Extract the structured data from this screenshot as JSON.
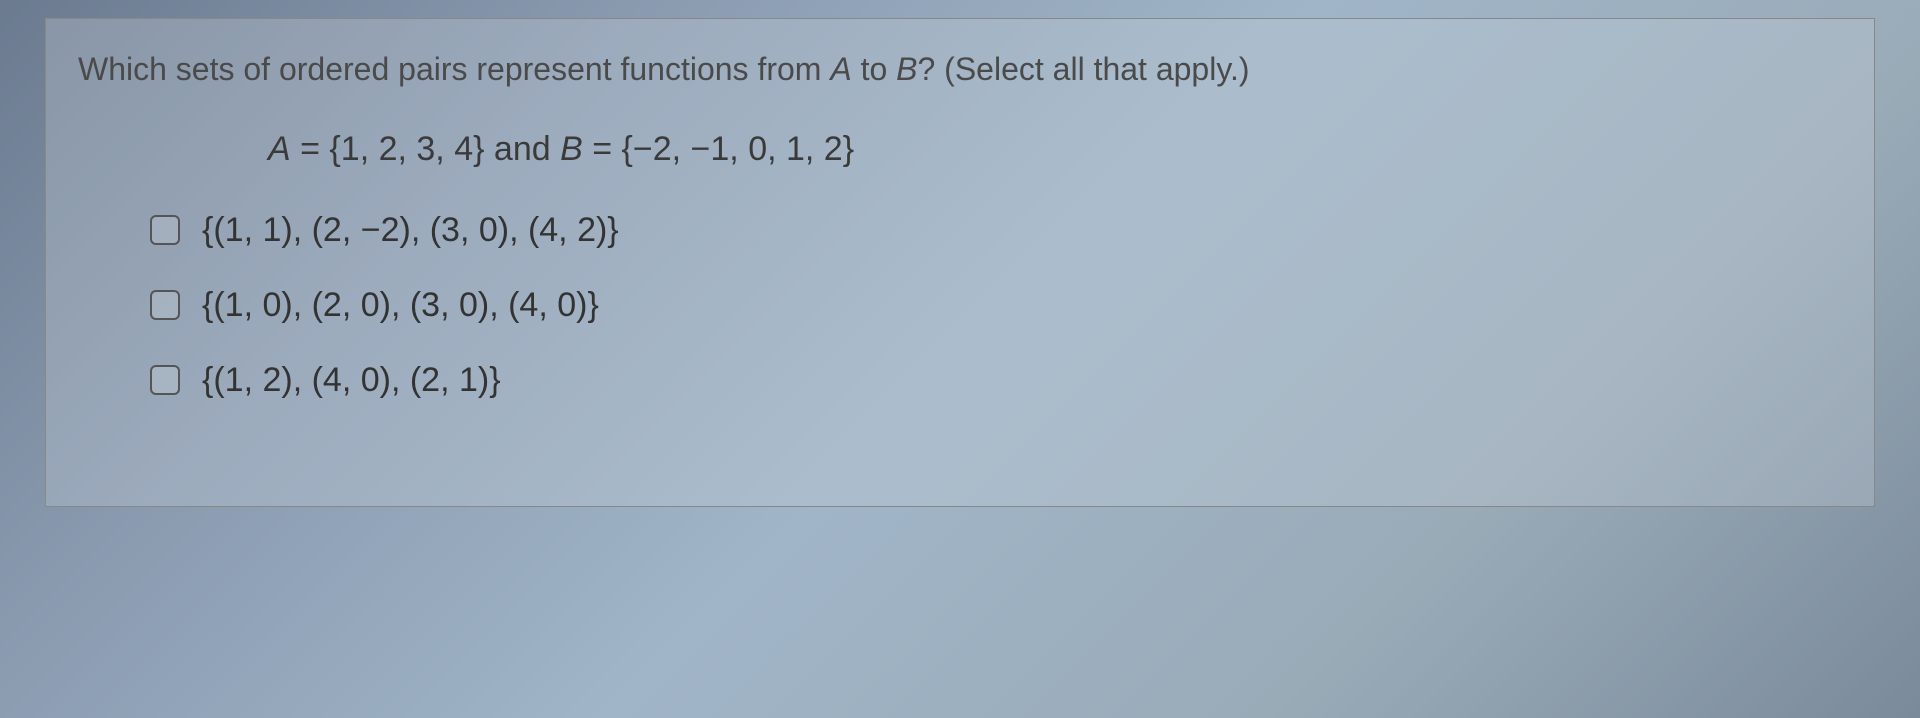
{
  "question": {
    "prompt_pre": "Which sets of ordered pairs represent functions from ",
    "var_a": "A",
    "prompt_mid": " to ",
    "var_b": "B",
    "prompt_post": "? (Select all that apply.)"
  },
  "sets": {
    "a_label": "A",
    "a_eq": " = {1, 2, 3, 4} and ",
    "b_label": "B",
    "b_eq": " = {−2, −1, 0, 1, 2}"
  },
  "options": [
    {
      "text": "{(1, 1), (2, −2), (3, 0), (4, 2)}"
    },
    {
      "text": "{(1, 0), (2, 0), (3, 0), (4, 0)}"
    },
    {
      "text": "{(1, 2), (4, 0), (2, 1)}"
    }
  ]
}
